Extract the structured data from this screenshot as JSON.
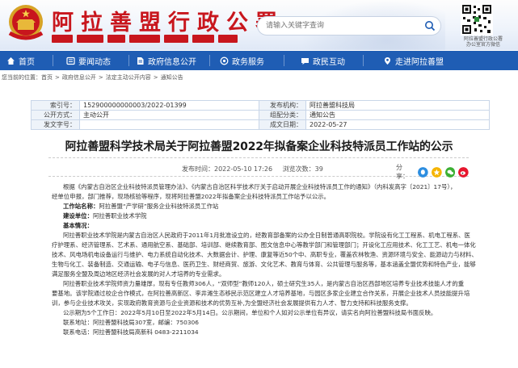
{
  "header": {
    "site_title": "阿拉善盟行政公署",
    "search_placeholder": "请输入关键字查询",
    "qr_caption_1": "阿拉善盟行政公署",
    "qr_caption_2": "办公室官方微信"
  },
  "nav": {
    "items": [
      {
        "label": "首页",
        "icon": "home-icon"
      },
      {
        "label": "要闻动态",
        "icon": "news-icon"
      },
      {
        "label": "政府信息公开",
        "icon": "document-icon"
      },
      {
        "label": "政务服务",
        "icon": "service-icon"
      },
      {
        "label": "政民互动",
        "icon": "chat-icon"
      },
      {
        "label": "走进阿拉善盟",
        "icon": "map-icon"
      }
    ]
  },
  "breadcrumb": {
    "prefix": "您当前的位置：",
    "items": [
      "首页",
      "政府信息公开",
      "法定主动公开内容",
      "通知公告"
    ],
    "sep": ">"
  },
  "meta": {
    "index_label": "索引号：",
    "index_value": "152900000000003/2022-01399",
    "publisher_label": "发布机构：",
    "publisher_value": "阿拉善盟科技局",
    "method_label": "公开方式：",
    "method_value": "主动公开",
    "category_label": "组配分类：",
    "category_value": "通知公告",
    "docno_label": "发文字号：",
    "docno_value": "",
    "date_label": "成文日期：",
    "date_value": "2022-05-27"
  },
  "article": {
    "title": "阿拉善盟科学技术局关于阿拉善盟2022年拟备案企业科技特派员工作站的公示",
    "publish_time": "发布时间：2022-05-10 17:26",
    "views": "浏览次数：39",
    "share_label": "分享：",
    "share_icons": [
      "qq-icon",
      "qzone-icon",
      "wechat-icon",
      "weibo-icon"
    ],
    "colors": {
      "wechat": "#3cb034",
      "weibo": "#e6162d",
      "qq": "#2d8ee0",
      "qzone": "#f5b400"
    }
  },
  "body": {
    "p1": "根据《内蒙古自治区企业科技特派员管理办法》、《内蒙古自治区科学技术厅关于启动开展企业科技特派员工作的通知》（内科发高字〔2021〕17号），",
    "p1b": "经单位申报，部门推荐，现场核验等程序，现将阿拉善盟2022年拟备案企业科技特派员工作站予以公示。",
    "station_label": "工作站名称：",
    "station_value": "阿拉善盟“产学研”服务企业科技特派员工作站",
    "unit_label": "建设单位：",
    "unit_value": "阿拉善职业技术学院",
    "basic_label": "基本情况：",
    "p2": "阿拉善职业技术学院是内蒙古自治区人民政府于2011年1月批准设立的，经教育部备案的公办全日制普通高职院校。学院设有化工工程系、机电工程系、医",
    "p2b": "疗护理系、经济管理系、艺术系、通用航空系、基础部、培训部、继续教育部、图文信息中心等教学部门和管理部门；开设化工应用技术、化工工艺、机电一体化",
    "p2c": "技术、风电场机电设备运行与维护、电力系统自动化技术、大数据会计、护理、康复等近50个中、高职专业，覆盖农林牧渔、资源环境与安全、能源动力与材料、",
    "p2d": "生物与化工、装备制造、交通运输、电子与信息、医药卫生、财经商贸、旅游、文化艺术、教育与体育、公共管理与服务等，基本涵盖全盟优势和特色产业，能够",
    "p2e": "满足服务全盟及周边地区经济社会发展的对人才培养的专业需求。",
    "p3": "阿拉善职业技术学院师资力量雄厚，现有专任教师306人，“双师型”教师120人，硕士研究生35人，是内蒙古自治区西部地区培养专业技术技能人才的重",
    "p3b": "要基地。该学院通过校企合作模式，在阿拉善高新区、孪井滩生态移民示范区建立人才培养基地，与园区多家企业建立合作关系，开展企业技术人员技能提升培",
    "p3c": "训，参与企业技术攻关，实现政府教育资源与企业资源和技术的优势互补,为全盟经济社会发展提供有力人才、智力支持和科技服务支撑。",
    "p4": "公示期为5个工作日：2022年5月10日至2022年5月14日。公示期间，单位和个人如对公示单位有异议，请实名向阿拉善盟科技局书面反映。",
    "p5": "联系地址：阿拉善盟科技局307室，邮编：750306",
    "p6": "联系电话：阿拉善盟科技局高新科 0483-2211034"
  }
}
